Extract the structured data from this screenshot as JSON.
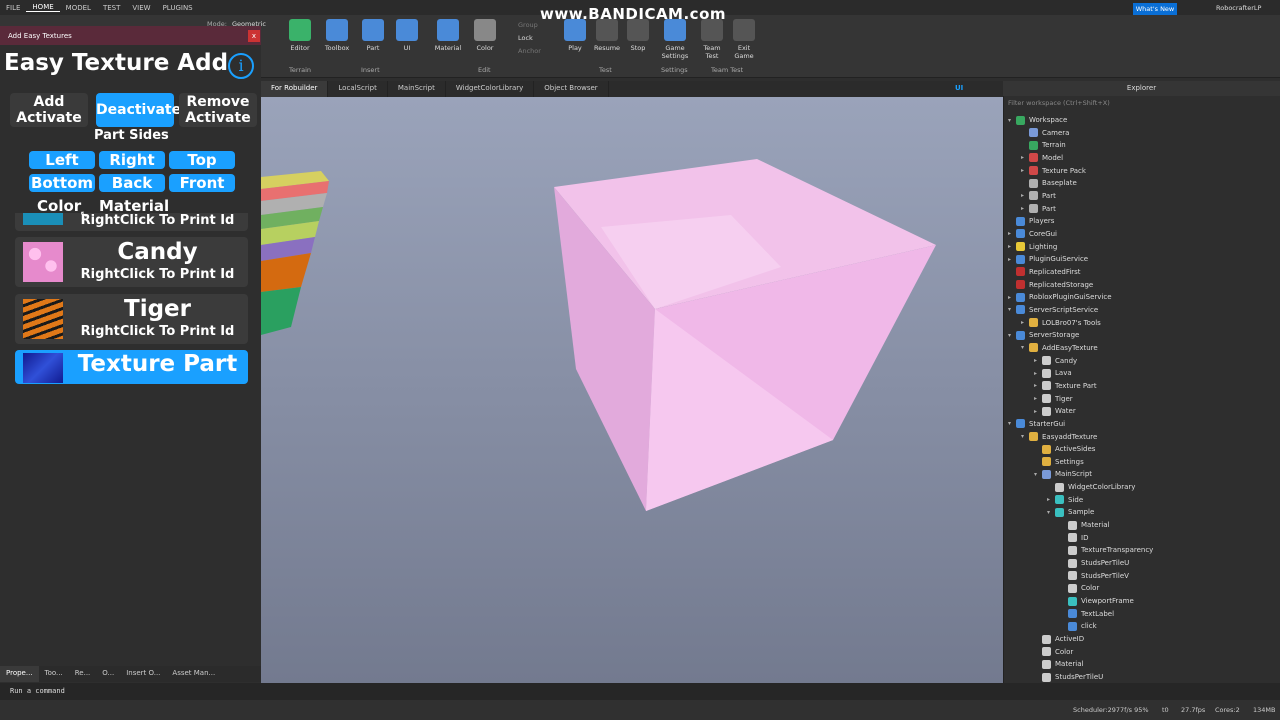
{
  "menubar": {
    "items": [
      "FILE",
      "HOME",
      "MODEL",
      "TEST",
      "VIEW",
      "PLUGINS"
    ],
    "active": "HOME"
  },
  "ribbon": {
    "buttons": [
      {
        "label": "Editor",
        "color": "#3ab26a"
      },
      {
        "label": "Toolbox",
        "color": "#4a8ad8"
      },
      {
        "label": "Part",
        "color": "#4a8ad8"
      },
      {
        "label": "UI",
        "color": "#4a8ad8"
      },
      {
        "label": "Material",
        "color": "#4a8ad8"
      },
      {
        "label": "Color",
        "color": "#888888"
      },
      {
        "label": "Play",
        "color": "#4a8ad8"
      },
      {
        "label": "Resume",
        "color": "#555555"
      },
      {
        "label": "Stop",
        "color": "#555555"
      },
      {
        "label": "Game Settings",
        "color": "#4a8ad8"
      },
      {
        "label": "Team Test",
        "color": "#555555"
      },
      {
        "label": "Exit Game",
        "color": "#555555"
      }
    ],
    "groups": [
      "Terrain",
      "Insert",
      "Edit",
      "Test",
      "Settings",
      "Team Test"
    ],
    "edit_small": [
      "Group",
      "Lock",
      "Anchor"
    ],
    "mode_label": "Mode:",
    "mode_value": "Geometric"
  },
  "watermark": "www.BANDICAM.com",
  "whats_new": "What's New",
  "username": "RobocrafterLP",
  "plugin": {
    "window_title": "Add Easy Textures",
    "close": "x",
    "title": "Easy Texture Add",
    "info": "i",
    "mode_buttons": [
      {
        "label": "Add Activate",
        "color": "#3a3a3a"
      },
      {
        "label": "Deactivate",
        "color": "#1aa0ff"
      },
      {
        "label": "Remove Activate",
        "color": "#3a3a3a"
      }
    ],
    "part_sides_label": "Part Sides",
    "sides": [
      "Left",
      "Right",
      "Top",
      "Bottom",
      "Back",
      "Front"
    ],
    "option_labels": [
      "Color",
      "Material"
    ],
    "partial_row_sub": "RightClick To Print Id",
    "textures": [
      {
        "name": "Candy",
        "sub": "RightClick To Print Id",
        "swatch": "#f09ad8"
      },
      {
        "name": "Tiger",
        "sub": "RightClick To Print Id",
        "swatch": "#d46a10"
      },
      {
        "name": "Texture Part",
        "sub": "",
        "swatch": "#2535b8",
        "selected": true
      }
    ]
  },
  "bottom_tabs": [
    "Prope...",
    "Too...",
    "Re...",
    "O...",
    "Insert O...",
    "Asset Man..."
  ],
  "command_bar": "Run a command",
  "status": {
    "scheduler": "Scheduler:2977f/s 95%",
    "t": "t0",
    "fps": "27.7fps",
    "cores": "Cores:2",
    "mem": "134MB"
  },
  "doc_tabs": [
    "For Robuilder",
    "LocalScript",
    "MainScript",
    "WidgetColorLibrary",
    "Object Browser"
  ],
  "viewport_badge": "UI",
  "explorer": {
    "title": "Explorer",
    "filter": "Filter workspace (Ctrl+Shift+X)",
    "tree": [
      {
        "label": "Workspace",
        "depth": 0,
        "arrow": "▾",
        "color": "#38a860"
      },
      {
        "label": "Camera",
        "depth": 1,
        "arrow": "",
        "color": "#7a9ad8"
      },
      {
        "label": "Terrain",
        "depth": 1,
        "arrow": "",
        "color": "#38a860"
      },
      {
        "label": "Model",
        "depth": 1,
        "arrow": "▸",
        "color": "#d04848"
      },
      {
        "label": "Texture Pack",
        "depth": 1,
        "arrow": "▸",
        "color": "#d04848"
      },
      {
        "label": "Baseplate",
        "depth": 1,
        "arrow": "",
        "color": "#b0b0b0"
      },
      {
        "label": "Part",
        "depth": 1,
        "arrow": "▸",
        "color": "#b0b0b0"
      },
      {
        "label": "Part",
        "depth": 1,
        "arrow": "▸",
        "color": "#b0b0b0"
      },
      {
        "label": "Players",
        "depth": 0,
        "arrow": "",
        "color": "#4a8ad8"
      },
      {
        "label": "CoreGui",
        "depth": 0,
        "arrow": "▸",
        "color": "#4a8ad8"
      },
      {
        "label": "Lighting",
        "depth": 0,
        "arrow": "▸",
        "color": "#e8c838"
      },
      {
        "label": "PluginGuiService",
        "depth": 0,
        "arrow": "▸",
        "color": "#4a8ad8"
      },
      {
        "label": "ReplicatedFirst",
        "depth": 0,
        "arrow": "",
        "color": "#c03030"
      },
      {
        "label": "ReplicatedStorage",
        "depth": 0,
        "arrow": "",
        "color": "#c03030"
      },
      {
        "label": "RobloxPluginGuiService",
        "depth": 0,
        "arrow": "▸",
        "color": "#4a8ad8"
      },
      {
        "label": "ServerScriptService",
        "depth": 0,
        "arrow": "▾",
        "color": "#4a8ad8"
      },
      {
        "label": "LOLBro07's Tools",
        "depth": 1,
        "arrow": "▸",
        "color": "#e0b040"
      },
      {
        "label": "ServerStorage",
        "depth": 0,
        "arrow": "▾",
        "color": "#4a8ad8"
      },
      {
        "label": "AddEasyTexture",
        "depth": 1,
        "arrow": "▾",
        "color": "#e0b040"
      },
      {
        "label": "Candy",
        "depth": 2,
        "arrow": "▸",
        "color": "#cccccc"
      },
      {
        "label": "Lava",
        "depth": 2,
        "arrow": "▸",
        "color": "#cccccc"
      },
      {
        "label": "Texture Part",
        "depth": 2,
        "arrow": "▸",
        "color": "#cccccc"
      },
      {
        "label": "Tiger",
        "depth": 2,
        "arrow": "▸",
        "color": "#cccccc"
      },
      {
        "label": "Water",
        "depth": 2,
        "arrow": "▸",
        "color": "#cccccc"
      },
      {
        "label": "StarterGui",
        "depth": 0,
        "arrow": "▾",
        "color": "#4a8ad8"
      },
      {
        "label": "EasyaddTexture",
        "depth": 1,
        "arrow": "▾",
        "color": "#e0b040"
      },
      {
        "label": "ActiveSides",
        "depth": 2,
        "arrow": "",
        "color": "#e0b040"
      },
      {
        "label": "Settings",
        "depth": 2,
        "arrow": "",
        "color": "#e0b040"
      },
      {
        "label": "MainScript",
        "depth": 2,
        "arrow": "▾",
        "color": "#7a9ad8"
      },
      {
        "label": "WidgetColorLibrary",
        "depth": 3,
        "arrow": "",
        "color": "#cccccc"
      },
      {
        "label": "Side",
        "depth": 3,
        "arrow": "▸",
        "color": "#3ac0c0"
      },
      {
        "label": "Sample",
        "depth": 3,
        "arrow": "▾",
        "color": "#3ac0c0"
      },
      {
        "label": "Material",
        "depth": 4,
        "arrow": "",
        "color": "#cccccc"
      },
      {
        "label": "ID",
        "depth": 4,
        "arrow": "",
        "color": "#cccccc"
      },
      {
        "label": "TextureTransparency",
        "depth": 4,
        "arrow": "",
        "color": "#cccccc"
      },
      {
        "label": "StudsPerTileU",
        "depth": 4,
        "arrow": "",
        "color": "#cccccc"
      },
      {
        "label": "StudsPerTileV",
        "depth": 4,
        "arrow": "",
        "color": "#cccccc"
      },
      {
        "label": "Color",
        "depth": 4,
        "arrow": "",
        "color": "#cccccc"
      },
      {
        "label": "ViewportFrame",
        "depth": 4,
        "arrow": "",
        "color": "#3ac0c0"
      },
      {
        "label": "TextLabel",
        "depth": 4,
        "arrow": "",
        "color": "#4a8ad8"
      },
      {
        "label": "click",
        "depth": 4,
        "arrow": "",
        "color": "#4a8ad8"
      },
      {
        "label": "ActiveID",
        "depth": 2,
        "arrow": "",
        "color": "#cccccc"
      },
      {
        "label": "Color",
        "depth": 2,
        "arrow": "",
        "color": "#cccccc"
      },
      {
        "label": "Material",
        "depth": 2,
        "arrow": "",
        "color": "#cccccc"
      },
      {
        "label": "StudsPerTileU",
        "depth": 2,
        "arrow": "",
        "color": "#cccccc"
      }
    ]
  }
}
